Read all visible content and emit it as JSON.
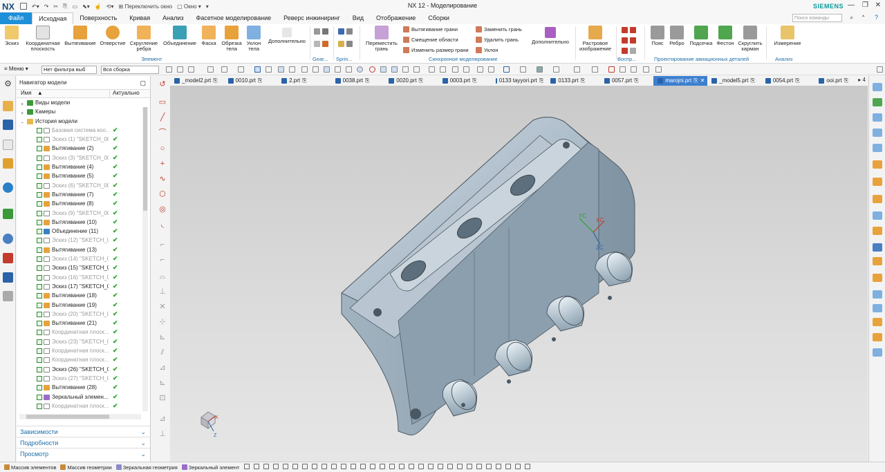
{
  "app": {
    "title": "NX 12 - Моделирование",
    "logo": "NX",
    "brand": "SIEMENS",
    "quick_access": {
      "switch_window": "Переключить окно",
      "window": "Окно"
    },
    "search_placeholder": "Поиск команды"
  },
  "menu_tabs": [
    "Файл",
    "Исходная",
    "Поверхность",
    "Кривая",
    "Анализ",
    "Фасетное моделирование",
    "Реверс инжиниринг",
    "Вид",
    "Отображение",
    "Сборки"
  ],
  "active_tab": "Исходная",
  "ribbon": {
    "element_buttons": [
      "Эскиз",
      "Координатная плоскость",
      "Вытягивание",
      "Отверстие",
      "Скругление ребра",
      "Объединение",
      "Фаска",
      "Обрезка тела",
      "Уклон тела",
      "Дополнительно"
    ],
    "element_group": "Элемент",
    "gear_group": "Gear...",
    "spring_group": "Sprin...",
    "sync": {
      "move_face": "Переместить грань",
      "small": [
        "Вытягивание грани",
        "Смещение области",
        "Изменить размер грани",
        "Заменить грань",
        "Удалить грань",
        "Уклон"
      ],
      "more": "Дополнительно",
      "group": "Синхронное моделирование"
    },
    "raster": "Растровое изображение",
    "repro_group": "Воспр...",
    "aero_buttons": [
      "Пояс",
      "Ребро",
      "Подсечка",
      "Фестон",
      "Скруглить карман"
    ],
    "aero_group": "Проектирование авиационных деталей",
    "measure": "Измерение",
    "analysis_group": "Анализ"
  },
  "selection_bar": {
    "menu": "Меню",
    "filter": "Нет фильтра выб",
    "scope": "Вся сборка"
  },
  "navigator": {
    "title": "Навигатор модели",
    "col_name": "Имя",
    "col_current": "Актуально",
    "top_nodes": [
      "Виды модели",
      "Камеры",
      "История модели"
    ],
    "rows": [
      {
        "label": "Базовая система коо...",
        "kind": "sk",
        "dim": true
      },
      {
        "label": "Эскиз (1) \"SKETCH_00...",
        "kind": "sk",
        "dim": true
      },
      {
        "label": "Вытягивание (2)",
        "kind": "ext",
        "dim": false
      },
      {
        "label": "Эскиз (3) \"SKETCH_00...",
        "kind": "sk",
        "dim": true
      },
      {
        "label": "Вытягивание (4)",
        "kind": "ext",
        "dim": false
      },
      {
        "label": "Вытягивание (5)",
        "kind": "ext",
        "dim": false
      },
      {
        "label": "Эскиз (6) \"SKETCH_00...",
        "kind": "sk",
        "dim": true
      },
      {
        "label": "Вытягивание (7)",
        "kind": "ext",
        "dim": false
      },
      {
        "label": "Вытягивание (8)",
        "kind": "ext",
        "dim": false
      },
      {
        "label": "Эскиз (9) \"SKETCH_00...",
        "kind": "sk",
        "dim": true
      },
      {
        "label": "Вытягивание (10)",
        "kind": "ext",
        "dim": false
      },
      {
        "label": "Объединение (11)",
        "kind": "un",
        "dim": false
      },
      {
        "label": "Эскиз (12) \"SKETCH_0...",
        "kind": "sk",
        "dim": true
      },
      {
        "label": "Вытягивание (13)",
        "kind": "ext",
        "dim": false
      },
      {
        "label": "Эскиз (14) \"SKETCH_0...",
        "kind": "sk",
        "dim": true
      },
      {
        "label": "Эскиз (15) \"SKETCH_0...",
        "kind": "sk",
        "dim": false
      },
      {
        "label": "Эскиз (16) \"SKETCH_0...",
        "kind": "sk",
        "dim": true
      },
      {
        "label": "Эскиз (17) \"SKETCH_0...",
        "kind": "sk",
        "dim": false
      },
      {
        "label": "Вытягивание (18)",
        "kind": "ext",
        "dim": false
      },
      {
        "label": "Вытягивание (19)",
        "kind": "ext",
        "dim": false
      },
      {
        "label": "Эскиз (20) \"SKETCH_0...",
        "kind": "sk",
        "dim": true
      },
      {
        "label": "Вытягивание (21)",
        "kind": "ext",
        "dim": false
      },
      {
        "label": "Координатная плоск...",
        "kind": "sk",
        "dim": true
      },
      {
        "label": "Эскиз (23) \"SKETCH_0...",
        "kind": "sk",
        "dim": true
      },
      {
        "label": "Координатная плоск...",
        "kind": "sk",
        "dim": true
      },
      {
        "label": "Координатная плоск...",
        "kind": "sk",
        "dim": true
      },
      {
        "label": "Эскиз (26) \"SKETCH_0...",
        "kind": "sk",
        "dim": false
      },
      {
        "label": "Эскиз (27) \"SKETCH_0...",
        "kind": "sk",
        "dim": true
      },
      {
        "label": "Вытягивание (28)",
        "kind": "ext",
        "dim": false
      },
      {
        "label": "Зеркальный элемен...",
        "kind": "mir",
        "dim": false
      },
      {
        "label": "Координатная плоск...",
        "kind": "sk",
        "dim": true
      }
    ],
    "panels": [
      "Зависимости",
      "Подробности",
      "Просмотр"
    ]
  },
  "part_tabs": [
    "_model2.prt",
    "0010.prt",
    "2.prt",
    "0038.prt",
    "0020.prt",
    "0003.prt",
    "0133 tayyori.prt",
    "0133.prt",
    "0057.prt",
    "marojni.prt",
    "_model5.prt",
    "0054.prt",
    "ooi.prt"
  ],
  "active_part": "marojni.prt",
  "tabs_more": "4",
  "triad_labels": {
    "yc": "YC",
    "xc": "XC",
    "zc": "ZC",
    "x": "X",
    "z": "Z"
  },
  "bottom_bar": [
    "Массив элементов",
    "Массив геометрии",
    "Зеркальная геометрия",
    "Зеркальный элемент"
  ]
}
